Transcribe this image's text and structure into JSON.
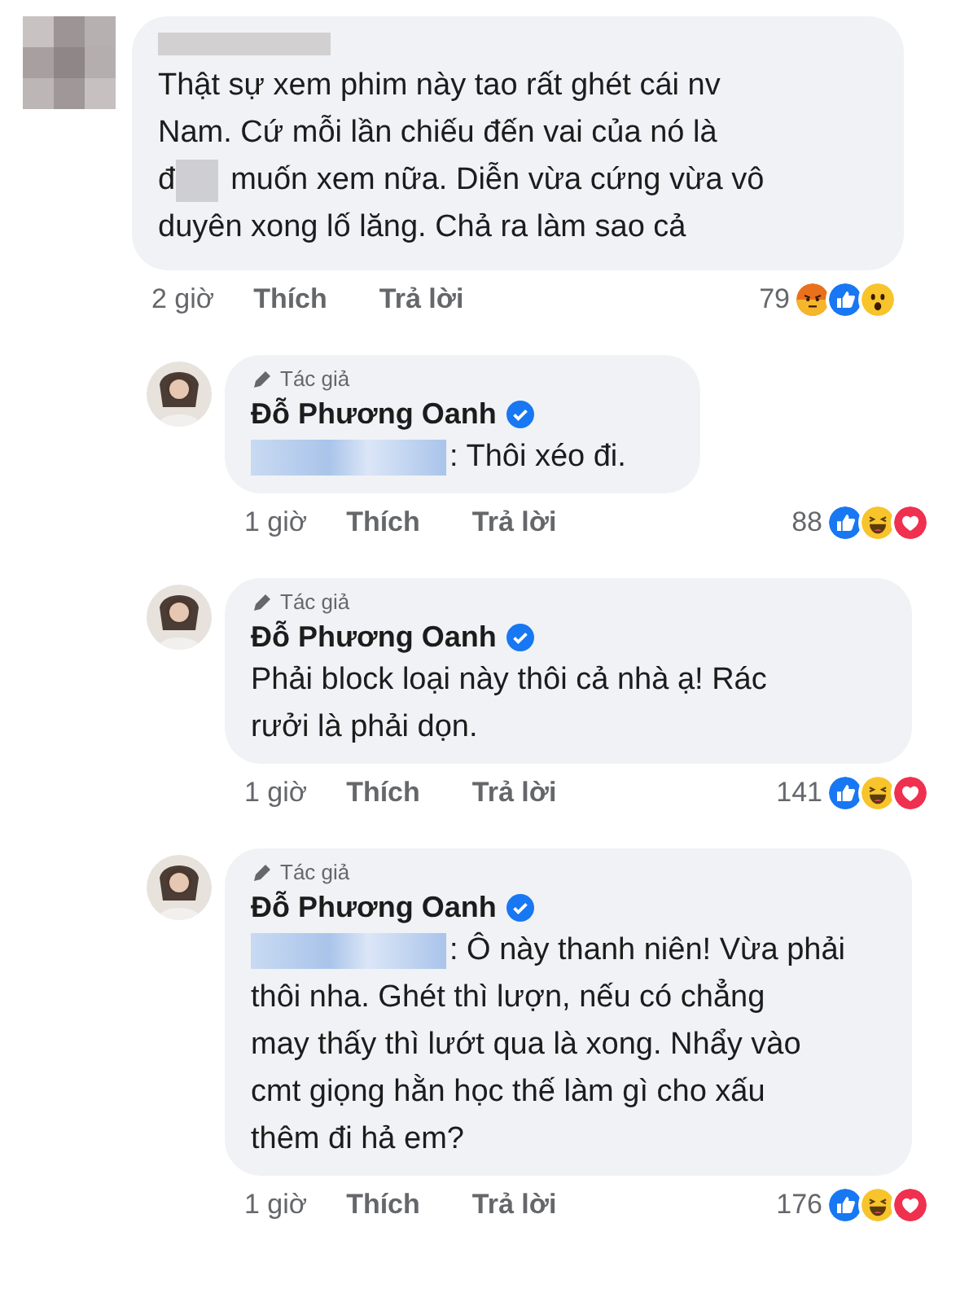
{
  "comments": [
    {
      "author_redacted": true,
      "lines": [
        {
          "text": "Thật sự xem phim này tao rất ghét cái nv"
        },
        {
          "text": "Nam. Cứ mỗi lần chiếu đến vai của nó là"
        },
        {
          "prefix": "đ",
          "redaction": {
            "kind": "word"
          },
          "text": "muốn xem nữa. Diễn vừa cứng vừa vô"
        },
        {
          "text": "duyên xong lố lăng. Chả ra làm sao cả"
        }
      ],
      "time": "2 giờ",
      "like": "Thích",
      "reply": "Trả lời",
      "count": "79",
      "reactions": [
        {
          "kind": "angry"
        },
        {
          "kind": "like"
        },
        {
          "kind": "wow"
        }
      ],
      "replies": [
        {
          "badge": "Tác giả",
          "author": "Đỗ Phương Oanh",
          "verified": true,
          "lines": [
            {
              "redaction": {
                "kind": "mention"
              },
              "text": ": Thôi xéo đi."
            }
          ],
          "time": "1 giờ",
          "like": "Thích",
          "reply": "Trả lời",
          "count": "88",
          "reactions": [
            {
              "kind": "like"
            },
            {
              "kind": "haha"
            },
            {
              "kind": "love"
            }
          ]
        },
        {
          "badge": "Tác giả",
          "author": "Đỗ Phương Oanh",
          "verified": true,
          "lines": [
            {
              "text": "Phải block loại này thôi cả nhà ạ! Rác"
            },
            {
              "text": "rưởi là phải dọn."
            }
          ],
          "time": "1 giờ",
          "like": "Thích",
          "reply": "Trả lời",
          "count": "141",
          "reactions": [
            {
              "kind": "like"
            },
            {
              "kind": "haha"
            },
            {
              "kind": "love"
            }
          ]
        },
        {
          "badge": "Tác giả",
          "author": "Đỗ Phương Oanh",
          "verified": true,
          "lines": [
            {
              "redaction": {
                "kind": "mention"
              },
              "text": ": Ô này thanh niên! Vừa phải"
            },
            {
              "text": "thôi nha. Ghét thì lượn, nếu có chẳng"
            },
            {
              "text": "may thấy thì lướt qua là xong. Nhẩy vào"
            },
            {
              "text": "cmt giọng hằn học thế làm gì cho xấu"
            },
            {
              "text": "thêm đi hả em?"
            }
          ],
          "time": "1 giờ",
          "like": "Thích",
          "reply": "Trả lời",
          "count": "176",
          "reactions": [
            {
              "kind": "like"
            },
            {
              "kind": "haha"
            },
            {
              "kind": "love"
            }
          ]
        }
      ]
    }
  ]
}
